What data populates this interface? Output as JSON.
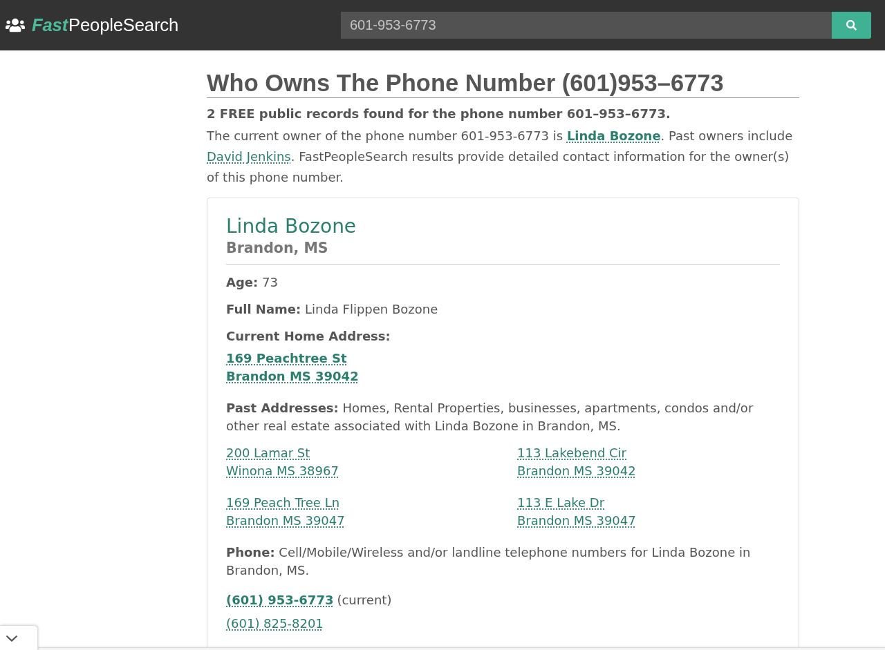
{
  "header": {
    "logo": {
      "accent": "Fast",
      "rest": "PeopleSearch"
    },
    "search": {
      "value": "601-953-6773"
    }
  },
  "heading": "Who Owns The Phone Number (601)953–6773",
  "summary": "2 FREE public records found for the phone number 601–953–6773.",
  "intro": [
    {
      "kind": "text",
      "text": "The current owner of the phone number 601-953-6773 is "
    },
    {
      "kind": "link",
      "text": "Linda Bozone",
      "bold": true
    },
    {
      "kind": "text",
      "text": ". Past owners include "
    },
    {
      "kind": "link",
      "text": "David Jenkins",
      "bold": false
    },
    {
      "kind": "text",
      "text": ". FastPeopleSearch results provide detailed contact information for the owner(s) of this phone number."
    }
  ],
  "record": {
    "name": "Linda Bozone",
    "location": "Brandon, MS",
    "age": {
      "label": "Age:",
      "value": "73"
    },
    "full_name": {
      "label": "Full Name:",
      "value": "Linda Flippen Bozone"
    },
    "current_address": {
      "label": "Current Home Address:",
      "lines": [
        "169 Peachtree St",
        "Brandon MS 39042"
      ]
    },
    "past_addresses": {
      "label": "Past Addresses:",
      "text": "Homes, Rental Properties, businesses, apartments, condos and/or other real estate associated with Linda Bozone in Brandon, MS.",
      "items": [
        {
          "lines": [
            "200 Lamar St",
            "Winona MS 38967"
          ]
        },
        {
          "lines": [
            "113 Lakebend Cir",
            "Brandon MS 39042"
          ]
        },
        {
          "lines": [
            "169 Peach Tree Ln",
            "Brandon MS 39047"
          ]
        },
        {
          "lines": [
            "113 E Lake Dr",
            "Brandon MS 39047"
          ]
        }
      ]
    },
    "phones": {
      "label": "Phone:",
      "text": "Cell/Mobile/Wireless and/or landline telephone numbers for Linda Bozone in Brandon, MS.",
      "items": [
        {
          "number": "(601) 953-6773",
          "current": true,
          "note": "(current)"
        },
        {
          "number": "(601) 825-8201",
          "current": false
        }
      ]
    }
  }
}
